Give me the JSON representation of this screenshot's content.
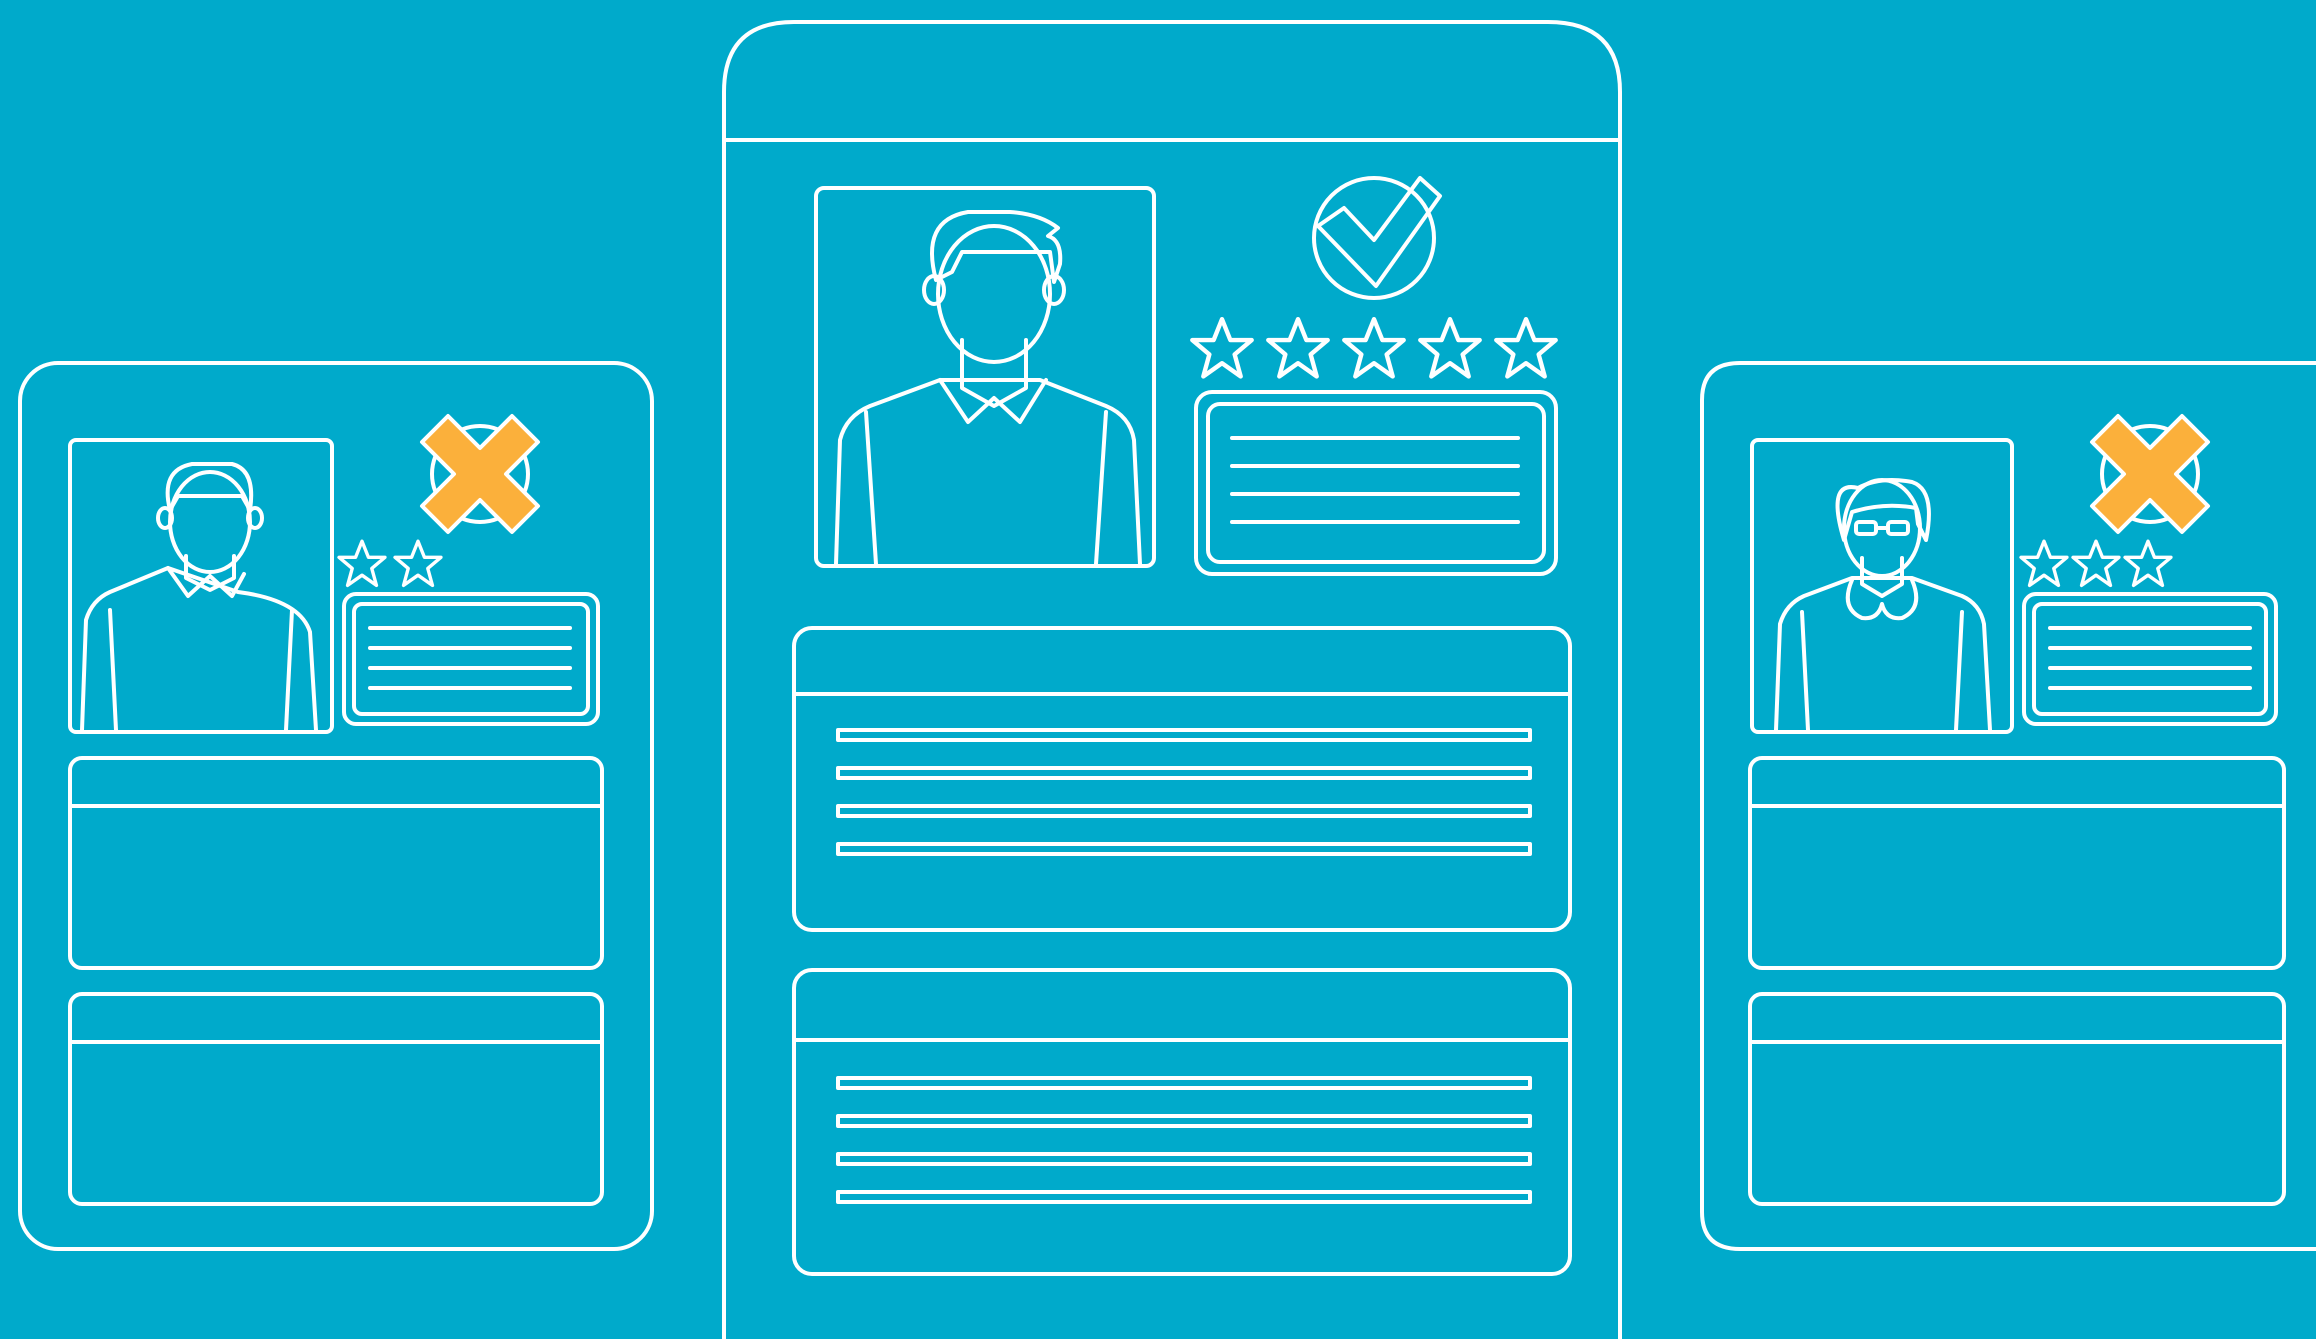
{
  "scene": {
    "background_color": "#00aacb",
    "line_color": "#ffffff",
    "reject_color": "#fbb03b"
  },
  "candidates": [
    {
      "name": "left",
      "rating": 2,
      "rating_max": 2,
      "status": "rejected",
      "status_icon": "x-mark-icon",
      "avatar": "man-avatar-icon"
    },
    {
      "name": "center",
      "rating": 5,
      "rating_max": 5,
      "status": "approved",
      "status_icon": "checkmark-circle-icon",
      "avatar": "man-avatar-icon"
    },
    {
      "name": "right",
      "rating": 3,
      "rating_max": 3,
      "status": "rejected",
      "status_icon": "x-mark-icon",
      "avatar": "woman-with-glasses-avatar-icon"
    }
  ]
}
